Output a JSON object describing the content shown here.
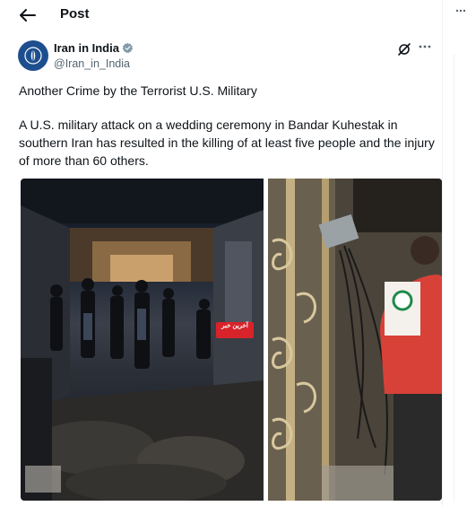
{
  "header": {
    "title": "Post"
  },
  "author": {
    "name": "Iran in India",
    "handle": "@Iran_in_India"
  },
  "post": {
    "line1": "Another Crime by the Terrorist U.S. Military",
    "line2": "A U.S. military attack on a wedding ceremony in Bandar Kuhestak in southern Iran has resulted in the killing of at least five people and the injury of more than 60 others."
  },
  "media": {
    "watermark_text": "آخرین خبر"
  },
  "colors": {
    "text": "#0f1419",
    "secondary": "#536471",
    "verified": "#829aab",
    "avatar_bg": "#1d4f8f"
  },
  "icons": [
    "back-arrow-icon",
    "verified-badge-icon",
    "grok-icon",
    "more-icon"
  ]
}
